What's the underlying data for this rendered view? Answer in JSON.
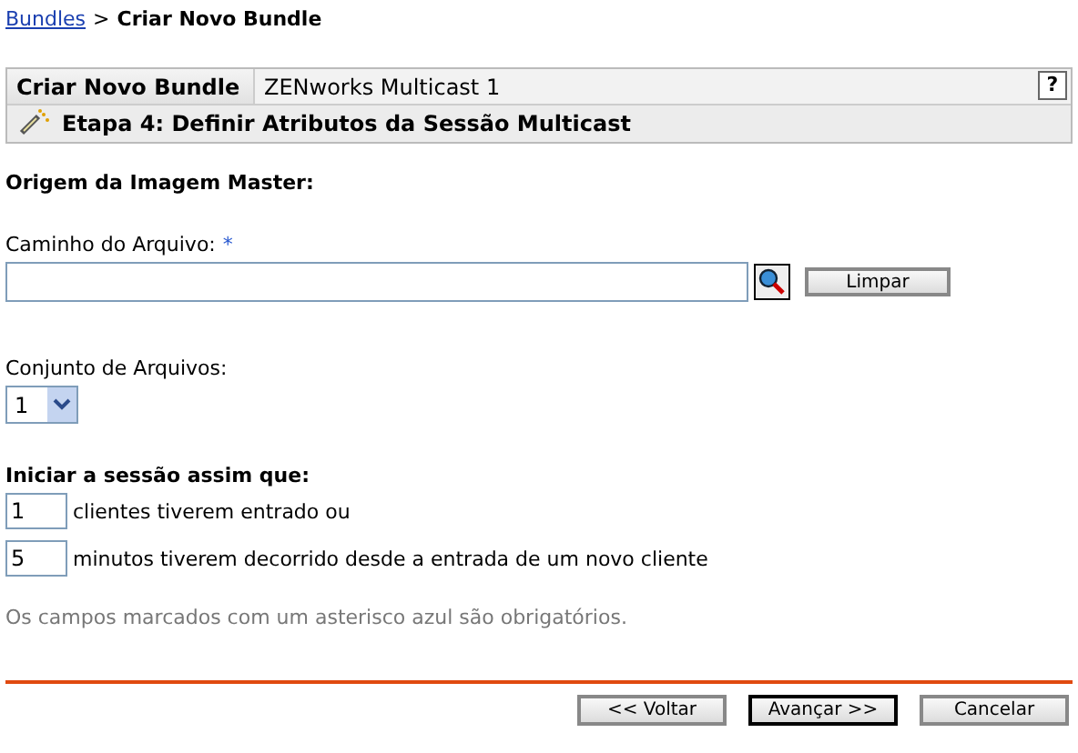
{
  "breadcrumb": {
    "link": "Bundles",
    "separator": ">",
    "current": "Criar Novo Bundle"
  },
  "header": {
    "tabs": [
      {
        "label": "Criar Novo Bundle",
        "selected": true
      },
      {
        "label": "ZENworks Multicast 1",
        "selected": false
      }
    ],
    "help": "?",
    "step": "Etapa 4: Definir Atributos da Sessão Multicast"
  },
  "section_title": "Origem da Imagem Master:",
  "file_path": {
    "label": "Caminho do Arquivo:",
    "required_mark": "*",
    "clear_button": "Limpar"
  },
  "file_set": {
    "label": "Conjunto de Arquivos:",
    "value": "1"
  },
  "start": {
    "title": "Iniciar a sessão assim que:",
    "conditions": [
      {
        "value": "1",
        "text": "clientes tiverem entrado ou"
      },
      {
        "value": "5",
        "text": "minutos tiverem decorrido desde a entrada de um novo cliente"
      }
    ]
  },
  "note": "Os campos marcados com um asterisco azul são obrigatórios.",
  "buttons": [
    {
      "label": "<< Voltar",
      "default": false
    },
    {
      "label": "Avançar >>",
      "default": true
    },
    {
      "label": "Cancelar",
      "default": false
    }
  ]
}
